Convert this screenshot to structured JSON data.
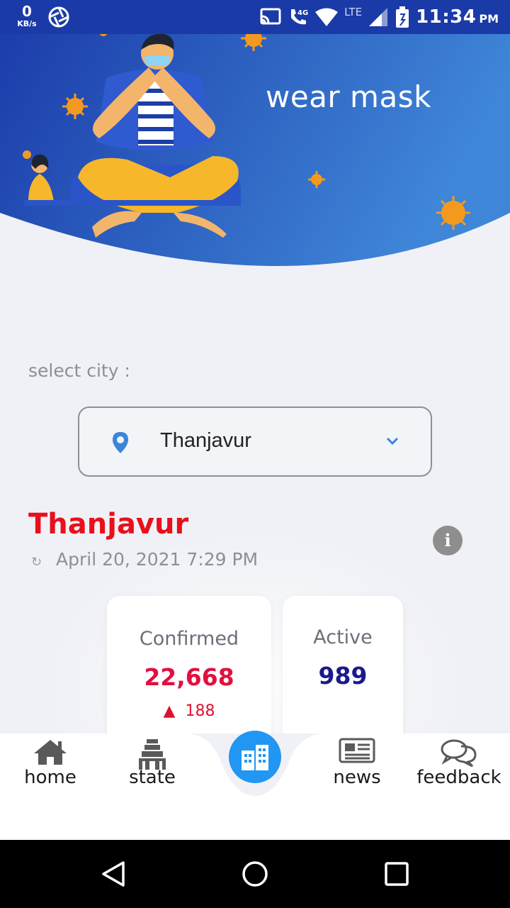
{
  "status_bar": {
    "data_speed_value": "0",
    "data_speed_unit": "KB/s",
    "network_label": "4G",
    "lte_label": "LTE",
    "time": "11:34",
    "ampm": "PM"
  },
  "header": {
    "title": "wear mask",
    "gradient_start": "#1a3aa8",
    "gradient_end": "#3f86d8",
    "virus_color": "#f39a1e"
  },
  "city_select": {
    "label": "select city :",
    "selected": "Thanjavur"
  },
  "city": {
    "name": "Thanjavur",
    "updated": "April 20, 2021 7:29 PM",
    "title_color": "#e8101c"
  },
  "cards": {
    "confirmed": {
      "label": "Confirmed",
      "value": "22,668",
      "delta": "188",
      "color": "#e01040"
    },
    "active": {
      "label": "Active",
      "value": "989",
      "color": "#1a1a8c"
    }
  },
  "nav": {
    "home": "home",
    "state": "state",
    "news": "news",
    "feedback": "feedback",
    "accent": "#2196f3"
  },
  "icons": [
    "aperture-icon",
    "cast-icon",
    "wifi-call-icon",
    "wifi-icon",
    "signal-icon",
    "battery-icon",
    "location-pin-icon",
    "chevron-down-icon",
    "refresh-icon",
    "info-icon",
    "home-icon",
    "temple-icon",
    "city-icon",
    "newspaper-icon",
    "chat-bubbles-icon",
    "back-icon",
    "home-circle-icon",
    "recents-icon"
  ]
}
